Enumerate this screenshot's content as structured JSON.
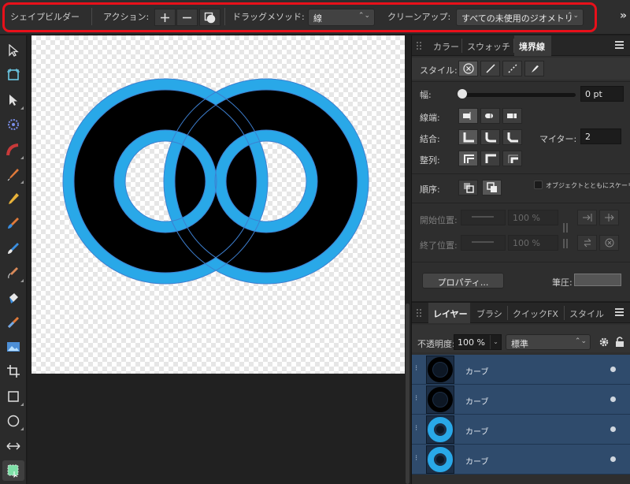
{
  "context_toolbar": {
    "tool_name": "シェイプビルダー",
    "action_label": "アクション:",
    "drag_method_label": "ドラッグメソッド:",
    "drag_method_value": "線",
    "cleanup_label": "クリーンアップ:",
    "cleanup_value": "すべての未使用のジオメトリ"
  },
  "tools": [
    "move-tool-icon",
    "artboard-tool-icon",
    "node-tool-icon",
    "point-transform-tool-icon",
    "corner-tool-icon",
    "pen-tool-icon",
    "pencil-tool-icon",
    "vector-brush-tool-icon",
    "paint-brush-tool-icon",
    "fill-tool-icon",
    "transparency-tool-icon",
    "place-image-tool-icon",
    "crop-tool-icon",
    "rectangle-tool-icon",
    "ellipse-tool-icon",
    "shape-builder-tool-icon"
  ],
  "canvas": {
    "stroke_color": "#29a8e8",
    "fill_color": "#000000",
    "outline_color": "#3d7fd0"
  },
  "stroke_panel": {
    "tabs": [
      "カラー",
      "スウォッチ",
      "境界線"
    ],
    "active_tab": "境界線",
    "style_label": "スタイル:",
    "width_label": "幅:",
    "width_value": "0 pt",
    "width_slider_fraction": 0,
    "cap_label": "線端:",
    "join_label": "結合:",
    "miter_label": "マイター:",
    "miter_value": "2",
    "align_label": "整列:",
    "order_label": "順序:",
    "scale_with_object_label": "オブジェクトとともにスケーリング",
    "start_label": "開始位置:",
    "end_label": "終了位置:",
    "start_percent": "100 %",
    "end_percent": "100 %",
    "properties_button": "プロパティ...",
    "pressure_label": "筆圧:"
  },
  "layers_panel": {
    "tabs": [
      "レイヤー",
      "ブラシ",
      "クイックFX",
      "スタイル"
    ],
    "active_tab": "レイヤー",
    "opacity_label": "不透明度:",
    "opacity_value": "100 %",
    "blend_mode": "標準",
    "layers": [
      {
        "name": "カーブ",
        "thumb": "black-ring"
      },
      {
        "name": "カーブ",
        "thumb": "black-ring"
      },
      {
        "name": "カーブ",
        "thumb": "blue-ring"
      },
      {
        "name": "カーブ",
        "thumb": "blue-ring"
      }
    ]
  }
}
